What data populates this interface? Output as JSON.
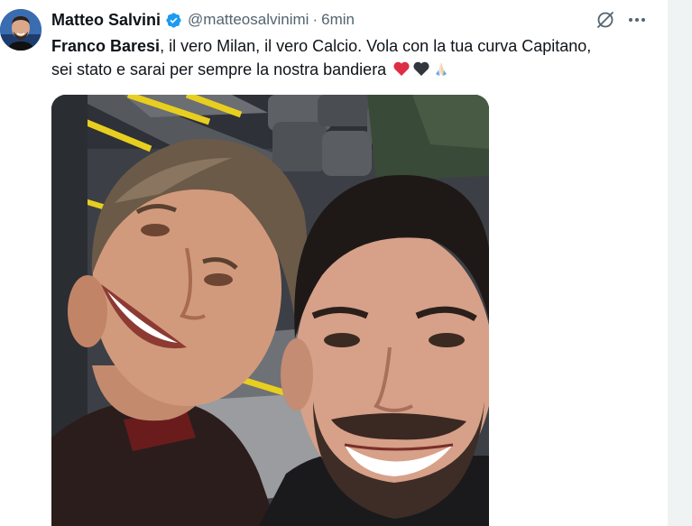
{
  "author": {
    "name": "Matteo Salvini",
    "handle": "@matteosalvinimi",
    "separator": "·",
    "time": "6min"
  },
  "tweet": {
    "mention": "Franco Baresi",
    "line1": ", il vero Milan, il vero Calcio. Vola con la tua curva Capitano,",
    "line2": "sei stato e sarai per sempre la nostra bandiera"
  },
  "icons": {
    "verified": "verified-badge-icon",
    "grok": "grok-icon",
    "more": "more-options-icon",
    "emoji_1": "red-heart-emoji",
    "emoji_2": "black-heart-emoji",
    "emoji_3": "folded-hands-emoji"
  },
  "colors": {
    "verified_blue": "#1d9bf0",
    "secondary_text": "#536471",
    "primary_text": "#0f1419"
  }
}
